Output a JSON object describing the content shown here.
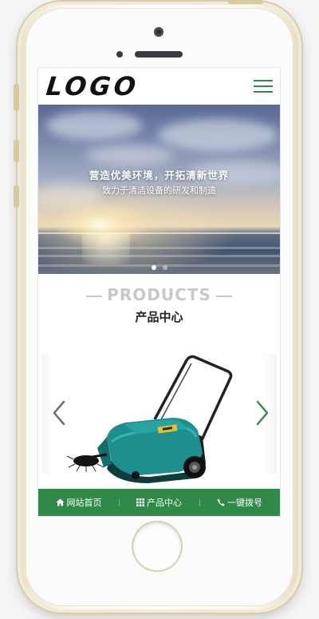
{
  "header": {
    "logo_text": "LOGO",
    "menu_icon": "hamburger-menu-icon"
  },
  "banner": {
    "title": "营造优美环境，开拓清新世界",
    "subtitle": "致力于清洁设备的研发和制造",
    "slides_total": 2,
    "active_slide": 1
  },
  "products_section": {
    "title_en": "PRODUCTS",
    "title_cn": "产品中心",
    "product_image": "floor-sweeper-machine",
    "prev_icon": "chevron-left-icon",
    "next_icon": "chevron-right-icon"
  },
  "footer": {
    "items": [
      {
        "icon": "home-icon",
        "label": "网站首页"
      },
      {
        "icon": "grid-icon",
        "label": "产品中心"
      },
      {
        "icon": "phone-icon",
        "label": "一键拨号"
      }
    ]
  },
  "colors": {
    "brand_green": "#2f8a47",
    "machine_teal": "#1d8f8f",
    "heading_gray": "#c8c8c8"
  }
}
